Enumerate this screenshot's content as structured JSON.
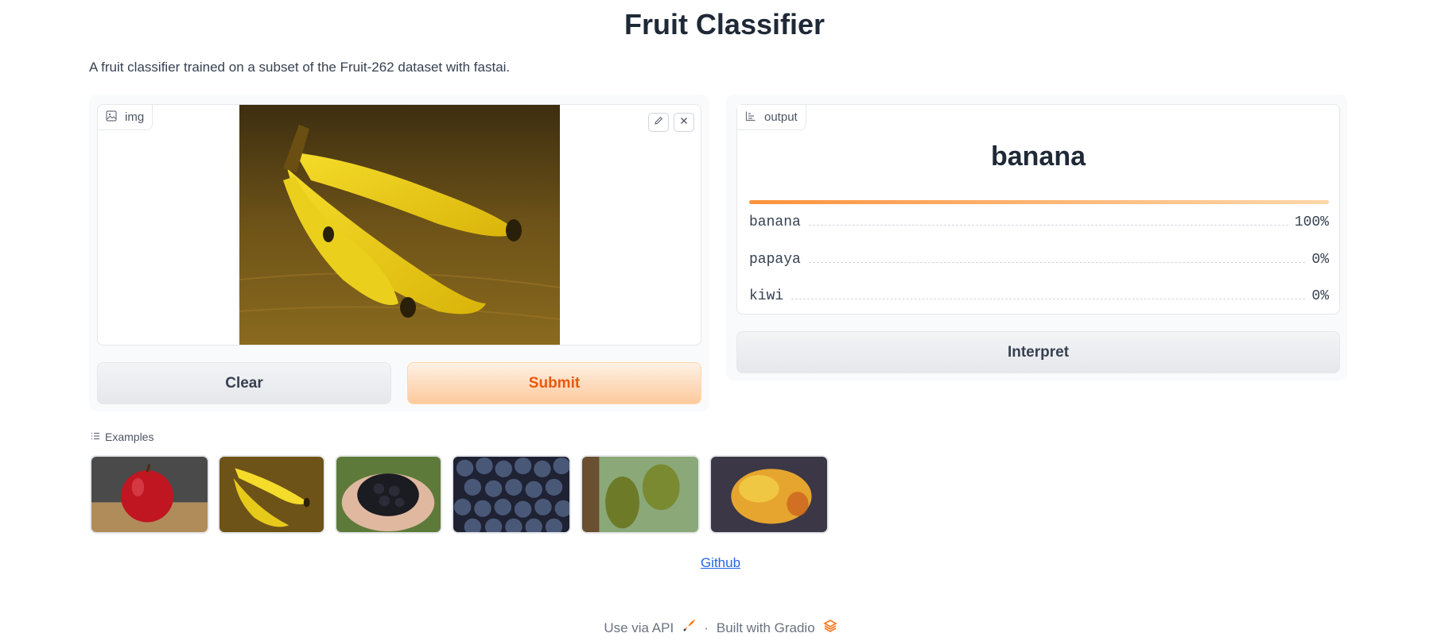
{
  "app": {
    "title": "Fruit Classifier",
    "description": "A fruit classifier trained on a subset of the Fruit-262 dataset with fastai."
  },
  "input": {
    "label": "img",
    "icon": "image-icon",
    "image_content": "bananas on a wooden table",
    "actions": [
      {
        "name": "edit",
        "icon": "pencil-icon"
      },
      {
        "name": "remove",
        "icon": "close-icon"
      }
    ]
  },
  "buttons": {
    "clear": "Clear",
    "submit": "Submit",
    "interpret": "Interpret"
  },
  "output": {
    "label": "output",
    "icon": "bar-chart-icon",
    "top_label": "banana",
    "top_confidence_fraction": 1.0,
    "confidences": [
      {
        "label": "banana",
        "value": "100%"
      },
      {
        "label": "papaya",
        "value": "0%"
      },
      {
        "label": "kiwi",
        "value": "0%"
      }
    ]
  },
  "examples": {
    "label": "Examples",
    "icon": "list-icon",
    "items": [
      "apple",
      "banana",
      "blackberry",
      "blueberry",
      "jackfruit",
      "mango"
    ]
  },
  "links": {
    "github": "Github"
  },
  "footer": {
    "api": "Use via API",
    "separator": "·",
    "built": "Built with Gradio"
  },
  "colors": {
    "accent": "#ea580c",
    "accent_light": "#fdc99c",
    "link": "#2563eb"
  }
}
